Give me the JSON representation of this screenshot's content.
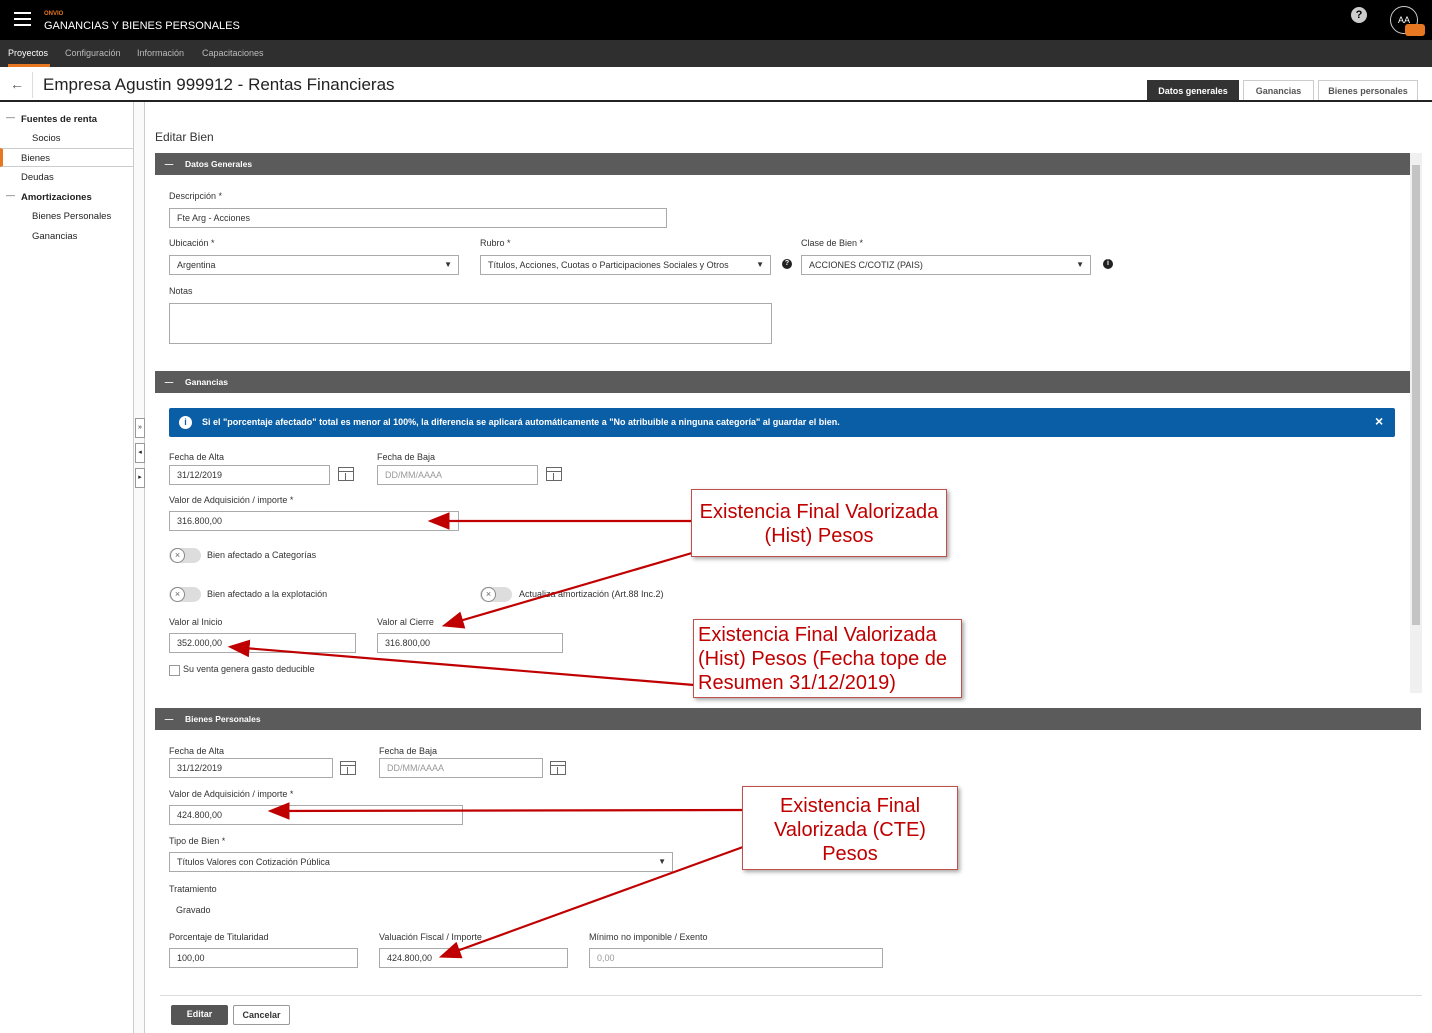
{
  "app": {
    "brand": "ONVIO",
    "title": "GANANCIAS Y BIENES PERSONALES",
    "avatar": "AA",
    "help": "?"
  },
  "menu": [
    "Proyectos",
    "Configuración",
    "Información",
    "Capacitaciones"
  ],
  "page": {
    "back": "←",
    "title": "Empresa Agustin 999912 - Rentas Financieras"
  },
  "tabs": [
    "Datos generales",
    "Ganancias",
    "Bienes personales"
  ],
  "sidebar": {
    "items": [
      {
        "label": "Fuentes de renta"
      },
      {
        "label": "Socios"
      },
      {
        "label": "Bienes"
      },
      {
        "label": "Deudas"
      },
      {
        "label": "Amortizaciones"
      },
      {
        "label": "Bienes Personales"
      },
      {
        "label": "Ganancias"
      }
    ],
    "collapse": "—"
  },
  "form": {
    "heading": "Editar Bien",
    "general": {
      "section": "Datos Generales",
      "descripcion_label": "Descripción *",
      "descripcion_value": "Fte Arg - Acciones",
      "ubicacion_label": "Ubicación *",
      "ubicacion_value": "Argentina",
      "rubro_label": "Rubro *",
      "rubro_value": "Títulos, Acciones, Cuotas o Participaciones Sociales y Otros",
      "clase_label": "Clase de Bien *",
      "clase_value": "ACCIONES C/COTIZ   (PAIS)",
      "notas_label": "Notas"
    },
    "ganancias": {
      "section": "Ganancias",
      "banner": "Si el \"porcentaje afectado\" total es menor al 100%, la diferencia se aplicará automáticamente a \"No atribuible a ninguna categoría\" al guardar el bien.",
      "banner_close": "×",
      "fecha_alta_label": "Fecha de Alta",
      "fecha_alta_value": "31/12/2019",
      "fecha_baja_label": "Fecha de Baja",
      "fecha_baja_placeholder": "DD/MM/AAAA",
      "valor_adq_label": "Valor de Adquisición / importe *",
      "valor_adq_value": "316.800,00",
      "toggle_categorias": "Bien afectado a Categorías",
      "toggle_explotacion": "Bien afectado a la explotación",
      "toggle_amortizacion": "Actualiza amortización (Art.88 Inc.2)",
      "valor_inicio_label": "Valor al Inicio",
      "valor_inicio_value": "352.000,00",
      "valor_cierre_label": "Valor al Cierre",
      "valor_cierre_value": "316.800,00",
      "checkbox_label": "Su venta genera gasto deducible"
    },
    "bienes": {
      "section": "Bienes Personales",
      "fecha_alta_label": "Fecha de Alta",
      "fecha_alta_value": "31/12/2019",
      "fecha_baja_label": "Fecha de Baja",
      "fecha_baja_placeholder": "DD/MM/AAAA",
      "valor_adq_label": "Valor de Adquisición / importe *",
      "valor_adq_value": "424.800,00",
      "tipo_label": "Tipo de Bien *",
      "tipo_value": "Títulos Valores con Cotización Pública",
      "tratamiento_label": "Tratamiento",
      "tratamiento_value": "Gravado",
      "titularidad_label": "Porcentaje de Titularidad",
      "titularidad_value": "100,00",
      "valuacion_label": "Valuación Fiscal / Importe",
      "valuacion_value": "424.800,00",
      "minimo_label": "Mínimo no imponible / Exento",
      "minimo_value": "0,00"
    },
    "buttons": {
      "edit": "Editar",
      "cancel": "Cancelar"
    }
  },
  "annotations": {
    "callout1": [
      "Existencia Final Valorizada",
      "(Hist) Pesos"
    ],
    "callout2": [
      "Existencia Final Valorizada",
      "(Hist) Pesos (Fecha tope de",
      "Resumen 31/12/2019)"
    ],
    "callout3": [
      "Existencia Final",
      "Valorizada (CTE)",
      "Pesos"
    ],
    "color": "#c00000"
  },
  "colors": {
    "accent": "#e87722",
    "banner": "#0a5ea5",
    "section": "#5b5b5b"
  }
}
